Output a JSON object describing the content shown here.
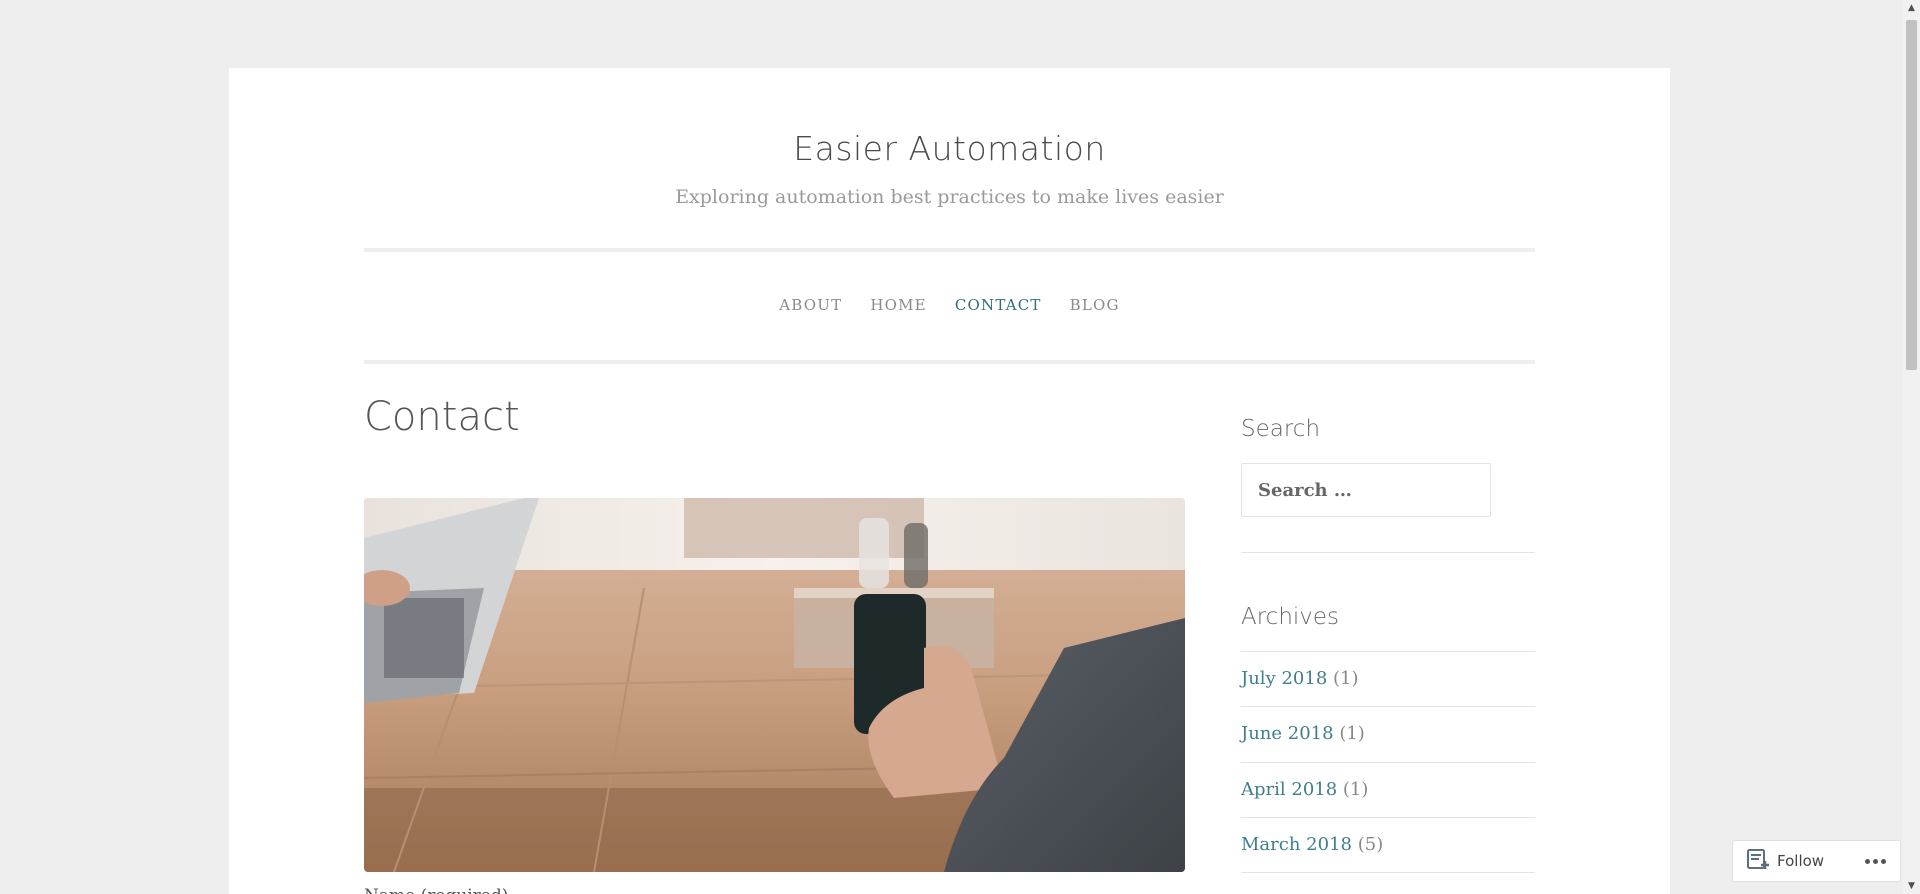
{
  "header": {
    "site_title": "Easier Automation",
    "tagline": "Exploring automation best practices to make lives easier"
  },
  "nav": {
    "items": [
      {
        "label": "ABOUT"
      },
      {
        "label": "HOME"
      },
      {
        "label": "CONTACT",
        "active": true
      },
      {
        "label": "BLOG"
      }
    ]
  },
  "main": {
    "page_title": "Contact",
    "form_label_partial": "Name (required)"
  },
  "sidebar": {
    "search": {
      "title": "Search",
      "placeholder": "Search …"
    },
    "archives": {
      "title": "Archives",
      "items": [
        {
          "label": "July 2018",
          "count": "(1)"
        },
        {
          "label": "June 2018",
          "count": "(1)"
        },
        {
          "label": "April 2018",
          "count": "(1)"
        },
        {
          "label": "March 2018",
          "count": "(5)"
        }
      ]
    }
  },
  "follow": {
    "label": "Follow"
  },
  "colors": {
    "accent": "#2f6f7f",
    "link": "#3f7f8d",
    "background": "#eeeeee"
  }
}
